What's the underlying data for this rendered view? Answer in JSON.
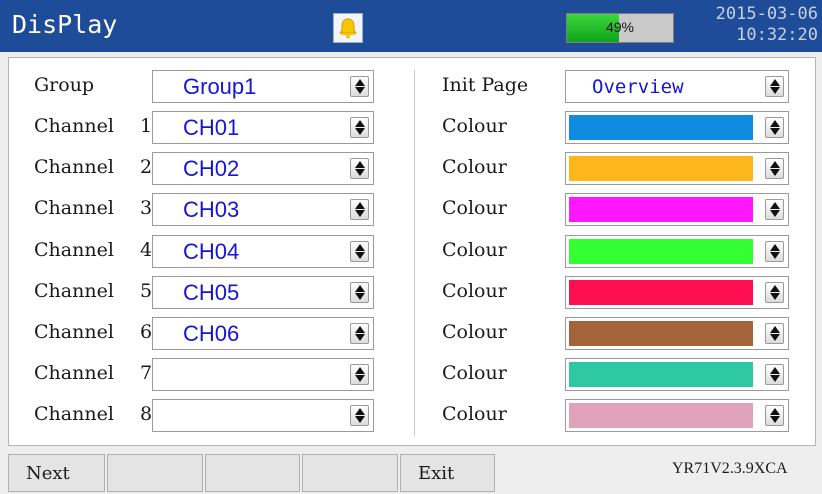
{
  "header": {
    "title": "DisPlay",
    "date": "2015-03-06",
    "time": "10:32:20",
    "battery": {
      "label": "49%",
      "level": 0.49
    }
  },
  "left": {
    "group": {
      "label": "Group",
      "value": "Group1"
    },
    "channels": [
      {
        "name": "Channel",
        "num": "1",
        "value": "CH01"
      },
      {
        "name": "Channel",
        "num": "2",
        "value": "CH02"
      },
      {
        "name": "Channel",
        "num": "3",
        "value": "CH03"
      },
      {
        "name": "Channel",
        "num": "4",
        "value": "CH04"
      },
      {
        "name": "Channel",
        "num": "5",
        "value": "CH05"
      },
      {
        "name": "Channel",
        "num": "6",
        "value": "CH06"
      },
      {
        "name": "Channel",
        "num": "7",
        "value": ""
      },
      {
        "name": "Channel",
        "num": "8",
        "value": ""
      }
    ]
  },
  "right": {
    "init_page": {
      "label": "Init Page",
      "value": "Overview"
    },
    "colours": [
      {
        "label": "Colour",
        "color": "#0f8ce0"
      },
      {
        "label": "Colour",
        "color": "#fdb71c"
      },
      {
        "label": "Colour",
        "color": "#ff18ff"
      },
      {
        "label": "Colour",
        "color": "#33ff33"
      },
      {
        "label": "Colour",
        "color": "#ff0f4f"
      },
      {
        "label": "Colour",
        "color": "#a4643a"
      },
      {
        "label": "Colour",
        "color": "#2ec9a0"
      },
      {
        "label": "Colour",
        "color": "#dfa2b9"
      }
    ]
  },
  "bottom": {
    "buttons": [
      {
        "label": "Next"
      },
      {
        "label": ""
      },
      {
        "label": ""
      },
      {
        "label": ""
      },
      {
        "label": "Exit"
      }
    ],
    "version": "YR71V2.3.9XCA"
  }
}
